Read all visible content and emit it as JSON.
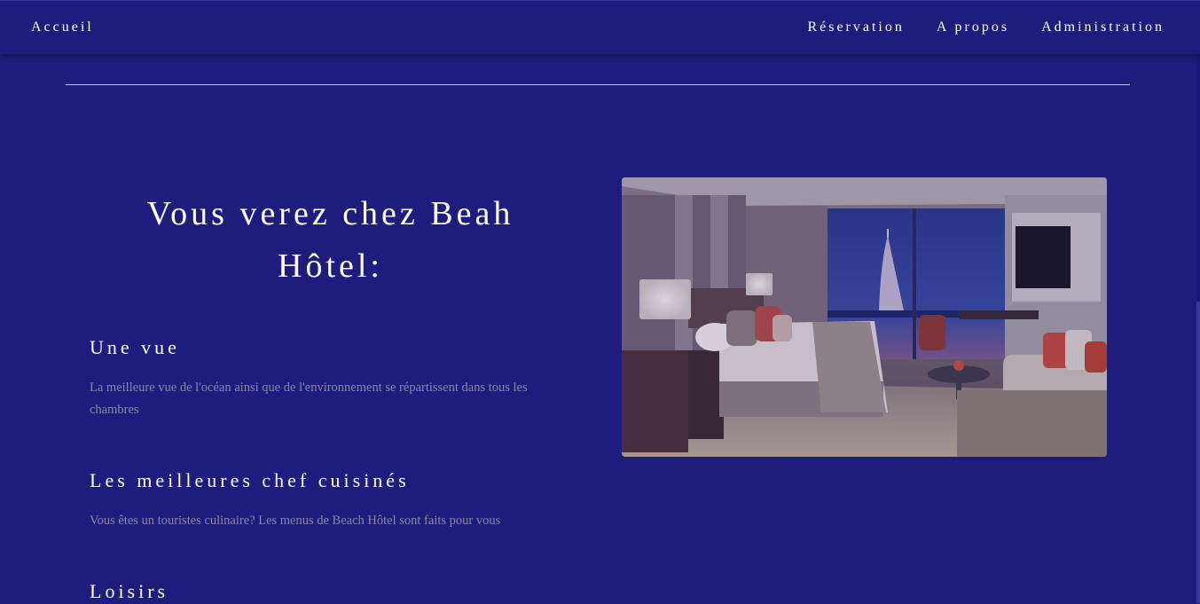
{
  "nav": {
    "brand": "Accueil",
    "links": [
      "Réservation",
      "A propos",
      "Administration"
    ]
  },
  "section": {
    "title": "Vous verez chez Beah Hôtel:",
    "features": [
      {
        "heading": "Une vue",
        "text": "La meilleure vue de l'océan ainsi que de l'environnement se répartissent dans tous les chambres"
      },
      {
        "heading": "Les meilleures chef cuisinés",
        "text": "Vous êtes un touristes culinaire? Les menus de Beach Hôtel sont faits pour vous"
      },
      {
        "heading": "Loisirs",
        "text": ""
      }
    ]
  },
  "colors": {
    "background": "#1e1c7c",
    "heading": "#ffffff",
    "body_text": "#8a87a6"
  }
}
